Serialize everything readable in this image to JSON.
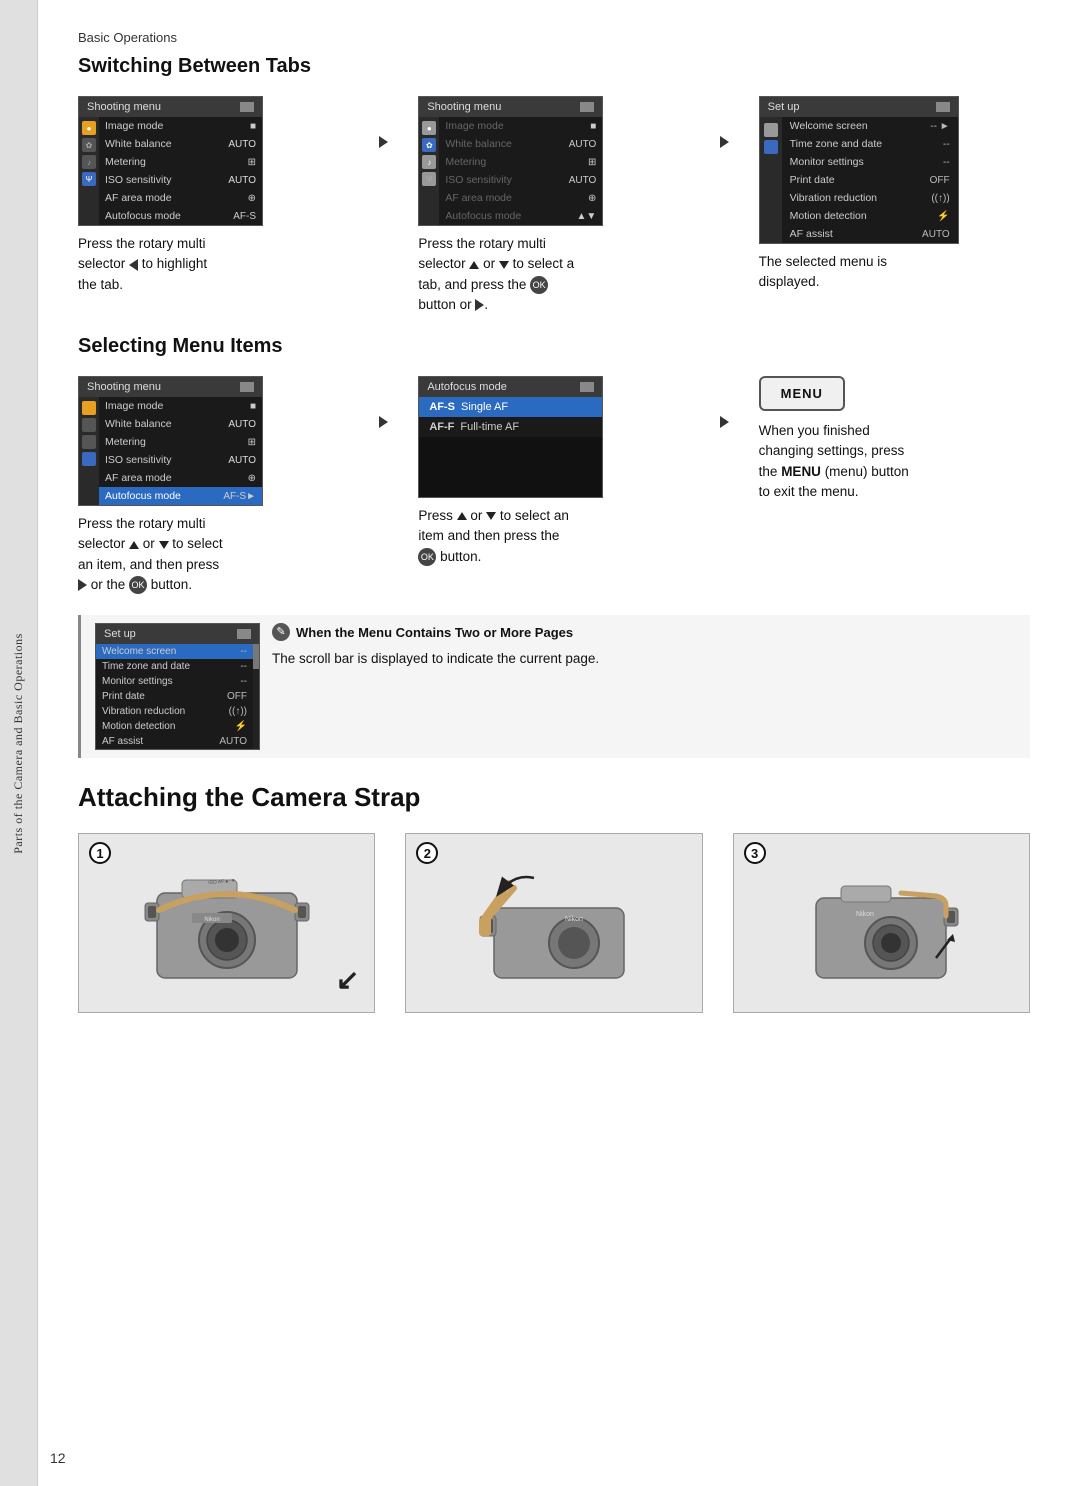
{
  "page": {
    "breadcrumb": "Basic Operations",
    "page_number": "12"
  },
  "side_tab": {
    "label": "Parts of the Camera and Basic Operations"
  },
  "switching_tabs": {
    "title": "Switching Between Tabs",
    "desc1": {
      "line1": "Press the rotary multi",
      "line2": "selector ◀ to highlight",
      "line3": "the tab."
    },
    "desc2": {
      "line1": "Press the rotary multi",
      "line2": "selector ▲ or ▼ to select a",
      "line3": "tab, and press the",
      "line4": "button or ▶."
    },
    "desc3": {
      "line1": "The selected menu is",
      "line2": "displayed."
    },
    "screen1": {
      "header": "Shooting menu",
      "rows": [
        {
          "label": "Image mode",
          "value": "■",
          "highlighted": false
        },
        {
          "label": "White balance",
          "value": "AUTO",
          "highlighted": false
        },
        {
          "label": "Metering",
          "value": "⊞",
          "highlighted": false
        },
        {
          "label": "ISO sensitivity",
          "value": "AUTO",
          "highlighted": false
        },
        {
          "label": "AF area mode",
          "value": "⊕",
          "highlighted": false
        },
        {
          "label": "Autofocus mode",
          "value": "AF-S",
          "highlighted": false
        }
      ]
    },
    "screen2": {
      "header": "Shooting menu",
      "rows": [
        {
          "label": "Image mode",
          "value": "■",
          "highlighted": true,
          "dimmed": true
        },
        {
          "label": "White balance",
          "value": "AUTO",
          "highlighted": false,
          "dimmed": true
        },
        {
          "label": "Metering",
          "value": "⊞",
          "highlighted": false,
          "dimmed": true
        },
        {
          "label": "ISO sensitivity",
          "value": "AUTO",
          "highlighted": false,
          "dimmed": true
        },
        {
          "label": "AF area mode",
          "value": "⊕",
          "highlighted": false,
          "dimmed": true
        },
        {
          "label": "Autofocus mode",
          "value": "▲▼",
          "highlighted": false,
          "dimmed": true
        }
      ]
    },
    "screen3": {
      "header": "Set up",
      "rows": [
        {
          "label": "Welcome screen",
          "value": "-- ►"
        },
        {
          "label": "Time zone and date",
          "value": "--"
        },
        {
          "label": "Monitor settings",
          "value": "--"
        },
        {
          "label": "Print date",
          "value": "OFF"
        },
        {
          "label": "Vibration reduction",
          "value": "(↑)"
        },
        {
          "label": "Motion detection",
          "value": "⚡"
        },
        {
          "label": "AF assist",
          "value": "AUTO"
        }
      ]
    }
  },
  "selecting_menu": {
    "title": "Selecting Menu Items",
    "screen1": {
      "header": "Shooting menu",
      "rows": [
        {
          "label": "Image mode",
          "value": "■"
        },
        {
          "label": "White balance",
          "value": "AUTO"
        },
        {
          "label": "Metering",
          "value": "⊞"
        },
        {
          "label": "ISO sensitivity",
          "value": "AUTO"
        },
        {
          "label": "AF area mode",
          "value": "⊕"
        },
        {
          "label": "Autofocus mode",
          "value": "AF-S►",
          "highlighted": true
        }
      ]
    },
    "screen2": {
      "header": "Autofocus mode",
      "rows": [
        {
          "code": "AF-S",
          "label": "Single AF",
          "highlighted": true
        },
        {
          "code": "AF-F",
          "label": "Full-time AF",
          "highlighted": false
        }
      ]
    },
    "desc1": {
      "line1": "Press the rotary multi",
      "line2": "selector ▲ or ▼ to select",
      "line3": "an item, and then press",
      "line4": "▶ or the  button."
    },
    "desc2": {
      "line1": "Press ▲ or ▼ to select an",
      "line2": "item and then press the",
      "line3": " button."
    },
    "desc3": {
      "line1": "When you finished",
      "line2": "changing settings, press",
      "line3": "the MENU (menu) button",
      "line4": "to exit the menu."
    },
    "menu_button_label": "MENU"
  },
  "note": {
    "title": "When the Menu Contains Two or More Pages",
    "body": "The scroll bar is displayed to indicate the current page.",
    "screen": {
      "header": "Set up",
      "rows": [
        {
          "label": "Welcome screen",
          "value": "--",
          "highlighted": true
        },
        {
          "label": "Time zone and date",
          "value": "--"
        },
        {
          "label": "Monitor settings",
          "value": "--"
        },
        {
          "label": "Print date",
          "value": "OFF"
        },
        {
          "label": "Vibration reduction",
          "value": "(↑)"
        },
        {
          "label": "Motion detection",
          "value": "⚡"
        },
        {
          "label": "AF assist",
          "value": "AUTO"
        }
      ]
    }
  },
  "attaching_strap": {
    "title": "Attaching the Camera Strap",
    "steps": [
      {
        "number": "1"
      },
      {
        "number": "2"
      },
      {
        "number": "3"
      }
    ]
  }
}
